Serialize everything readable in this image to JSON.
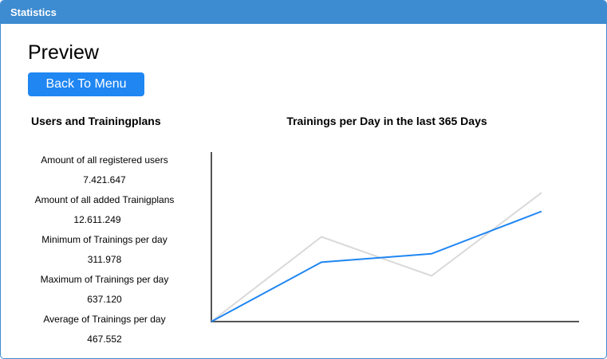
{
  "window": {
    "title": "Statistics"
  },
  "page": {
    "title": "Preview",
    "back_button_label": "Back To Menu"
  },
  "stats": {
    "heading": "Users and Trainingplans",
    "items": [
      {
        "label": "Amount of all registered users",
        "value": "7.421.647"
      },
      {
        "label": "Amount of all added Trainigplans",
        "value": "12.611.249"
      },
      {
        "label": "Minimum of Trainings per day",
        "value": "311.978"
      },
      {
        "label": "Maximum of Trainings per day",
        "value": "637.120"
      },
      {
        "label": "Average of Trainings per day",
        "value": "467.552"
      }
    ]
  },
  "chart_data": {
    "type": "line",
    "title": "Trainings per Day in the last 365 Days",
    "xlabel": "",
    "ylabel": "",
    "x": [
      0,
      1,
      2,
      3
    ],
    "ylim": [
      0,
      100
    ],
    "grid": false,
    "series": [
      {
        "values": [
          0,
          35,
          40,
          65
        ],
        "color": "#1f86f2"
      },
      {
        "values": [
          0,
          50,
          27,
          76
        ],
        "color": "#d9d9d9"
      }
    ]
  }
}
